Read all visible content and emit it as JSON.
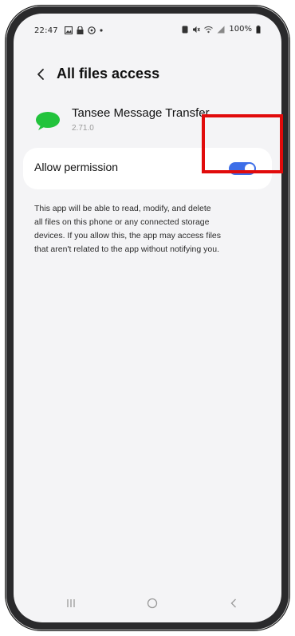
{
  "status_bar": {
    "time": "22:47",
    "left_icons": [
      "image-icon",
      "lock-icon",
      "chat-icon",
      "dot-icon"
    ],
    "right_icons": [
      "nfc-icon",
      "mute-icon",
      "wifi-icon",
      "signal-icon"
    ],
    "battery_text": "100%"
  },
  "header": {
    "back_icon": "chevron-left-icon",
    "title": "All files access"
  },
  "app": {
    "name": "Tansee Message Transfer",
    "version": "2.71.0",
    "icon": "green-chat-bubble-icon",
    "icon_color": "#22c33c"
  },
  "permission": {
    "label": "Allow permission",
    "enabled": true,
    "toggle_color": "#3d6ee8"
  },
  "description": {
    "lines": [
      "This app will be able to read, modify, and delete",
      "all files on this phone or any connected storage",
      "devices. If you allow this, the app may access files",
      "that aren't related to the app without notifying you."
    ]
  },
  "annotation": {
    "highlight_color": "#e10b0b"
  },
  "nav_bar": {
    "buttons": [
      "recents-icon",
      "home-icon",
      "back-icon"
    ]
  }
}
